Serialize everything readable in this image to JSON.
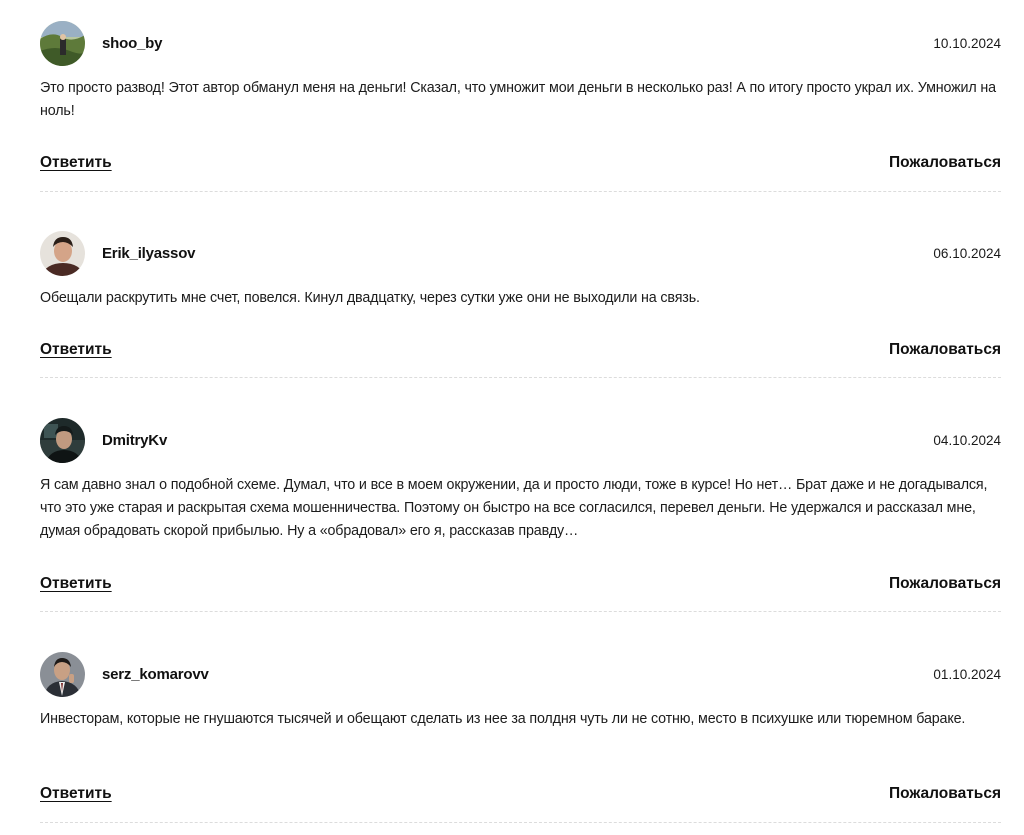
{
  "comments": [
    {
      "avatar": "avatar-landscape",
      "username": "shoo_by",
      "date": "10.10.2024",
      "text": "Это просто развод! Этот автор обманул меня на деньги! Сказал, что умножит мои деньги в несколько раз! А по итогу просто украл их. Умножил на ноль!",
      "reply_label": "Ответить",
      "report_label": "Пожаловаться"
    },
    {
      "avatar": "avatar-man-portrait",
      "username": "Erik_ilyassov",
      "date": "06.10.2024",
      "text": "Обещали раскрутить мне счет, повелся. Кинул двадцатку, через сутки уже они не выходили на связь.",
      "reply_label": "Ответить",
      "report_label": "Пожаловаться"
    },
    {
      "avatar": "avatar-man-car",
      "username": "DmitryKv",
      "date": "04.10.2024",
      "text": "Я сам давно знал о подобной схеме. Думал, что и все в моем окружении, да и просто люди, тоже в курсе! Но нет… Брат даже и не догадывался, что это уже старая и раскрытая схема мошенничества. Поэтому он быстро на все согласился, перевел деньги. Не удержался и рассказал мне, думая обрадовать скорой прибылью. Ну а «обрадовал» его я, рассказав правду…",
      "reply_label": "Ответить",
      "report_label": "Пожаловаться"
    },
    {
      "avatar": "avatar-man-suit",
      "username": "serz_komarovv",
      "date": "01.10.2024",
      "text": "Инвесторам, которые не гнушаются тысячей и обещают сделать из нее за полдня чуть ли не сотню, место в психушке или тюремном бараке.",
      "reply_label": "Ответить",
      "report_label": "Пожаловаться"
    }
  ]
}
